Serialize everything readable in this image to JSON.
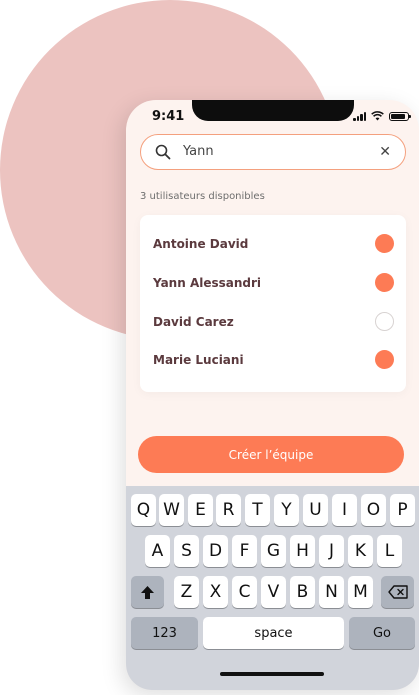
{
  "status_bar": {
    "time": "9:41",
    "icons": [
      "signal-icon",
      "wifi-icon",
      "battery-icon"
    ]
  },
  "search": {
    "value": "Yann",
    "clear_icon": "✕"
  },
  "list": {
    "count_label": "3 utilisateurs disponibles",
    "users": [
      {
        "name": "Antoine David",
        "selected": true
      },
      {
        "name": "Yann Alessandri",
        "selected": true
      },
      {
        "name": "David Carez",
        "selected": false
      },
      {
        "name": "Marie Luciani",
        "selected": true
      }
    ]
  },
  "cta": {
    "label": "Créer l’équipe"
  },
  "keyboard": {
    "row1": [
      "Q",
      "W",
      "E",
      "R",
      "T",
      "Y",
      "U",
      "I",
      "O",
      "P"
    ],
    "row2": [
      "A",
      "S",
      "D",
      "F",
      "G",
      "H",
      "J",
      "K",
      "L"
    ],
    "row3": [
      "Z",
      "X",
      "C",
      "V",
      "B",
      "N",
      "M"
    ],
    "numbers_label": "123",
    "space_label": "space",
    "go_label": "Go"
  },
  "colors": {
    "accent": "#fd7b55",
    "accent_border": "#f4a07e",
    "blob": "#ecc3c0",
    "name_text": "#5b3a3e",
    "screen_bg": "#fdf3ef"
  }
}
